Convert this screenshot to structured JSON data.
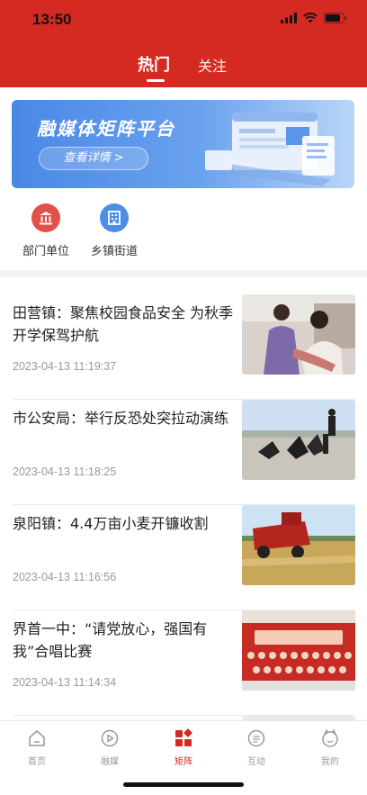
{
  "status_bar": {
    "time": "13:50"
  },
  "header": {
    "tabs": [
      {
        "label": "热门",
        "active": true
      },
      {
        "label": "关注",
        "active": false
      }
    ],
    "accent": "#d42a22"
  },
  "banner": {
    "title": "融媒体矩阵平台",
    "button": "查看详情 >"
  },
  "quick_entries": [
    {
      "label": "部门单位",
      "icon": "bank-icon",
      "color": "#e2504a"
    },
    {
      "label": "乡镇街道",
      "icon": "building-icon",
      "color": "#4a8ee8"
    }
  ],
  "news": [
    {
      "title": "田营镇：聚焦校园食品安全 为秋季开学保驾护航",
      "time": "2023-04-13 11:19:37"
    },
    {
      "title": "市公安局：举行反恐处突拉动演练",
      "time": "2023-04-13 11:18:25"
    },
    {
      "title": "泉阳镇：4.4万亩小麦开镰收割",
      "time": "2023-04-13 11:16:56"
    },
    {
      "title": "界首一中：“请党放心，强国有我”合唱比赛",
      "time": "2023-04-13 11:14:34"
    }
  ],
  "tab_bar": [
    {
      "label": "首页",
      "icon": "home-icon"
    },
    {
      "label": "融媒",
      "icon": "play-icon"
    },
    {
      "label": "矩阵",
      "icon": "grid-icon",
      "active": true
    },
    {
      "label": "互动",
      "icon": "chat-icon"
    },
    {
      "label": "我的",
      "icon": "face-icon"
    }
  ]
}
